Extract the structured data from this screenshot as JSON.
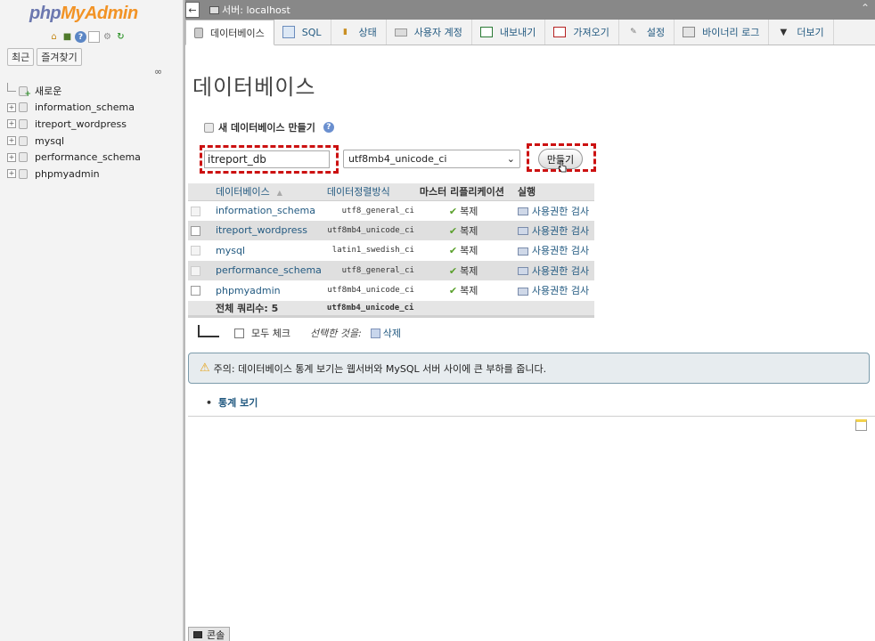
{
  "nav": {
    "logo_php": "php",
    "logo_myadmin": "MyAdmin",
    "tabs": [
      "최근",
      "즐겨찾기"
    ],
    "tree": [
      {
        "label": "새로운",
        "type": "new"
      },
      {
        "label": "information_schema",
        "type": "db"
      },
      {
        "label": "itreport_wordpress",
        "type": "db"
      },
      {
        "label": "mysql",
        "type": "db"
      },
      {
        "label": "performance_schema",
        "type": "db"
      },
      {
        "label": "phpmyadmin",
        "type": "db"
      }
    ]
  },
  "topbar": {
    "back": "←",
    "server": "서버: localhost",
    "collapse": "⌃"
  },
  "menu": [
    {
      "label": "데이터베이스",
      "icon": "database-icon",
      "active": true
    },
    {
      "label": "SQL",
      "icon": "sql-icon"
    },
    {
      "label": "상태",
      "icon": "status-icon"
    },
    {
      "label": "사용자 계정",
      "icon": "users-icon"
    },
    {
      "label": "내보내기",
      "icon": "export-icon"
    },
    {
      "label": "가져오기",
      "icon": "import-icon"
    },
    {
      "label": "설정",
      "icon": "settings-icon"
    },
    {
      "label": "바이너리 로그",
      "icon": "binary-log-icon"
    },
    {
      "label": "더보기",
      "icon": "more-icon"
    }
  ],
  "main": {
    "title": "데이터베이스",
    "create_heading": "새 데이터베이스 만들기",
    "db_name_value": "itreport_db",
    "collation_value": "utf8mb4_unicode_ci",
    "create_button": "만들기",
    "highlight_color": "#cc1111"
  },
  "table": {
    "headers": [
      "데이터베이스",
      "데이터정렬방식",
      "마스터 리플리케이션",
      "실행"
    ],
    "rows": [
      {
        "name": "information_schema",
        "collation": "utf8_general_ci",
        "replication": "복제",
        "action": "사용권한 검사",
        "system": true
      },
      {
        "name": "itreport_wordpress",
        "collation": "utf8mb4_unicode_ci",
        "replication": "복제",
        "action": "사용권한 검사",
        "system": false
      },
      {
        "name": "mysql",
        "collation": "latin1_swedish_ci",
        "replication": "복제",
        "action": "사용권한 검사",
        "system": true
      },
      {
        "name": "performance_schema",
        "collation": "utf8_general_ci",
        "replication": "복제",
        "action": "사용권한 검사",
        "system": true
      },
      {
        "name": "phpmyadmin",
        "collation": "utf8mb4_unicode_ci",
        "replication": "복제",
        "action": "사용권한 검사",
        "system": false
      }
    ],
    "footer_label": "전체 쿼리수: 5",
    "footer_collation": "utf8mb4_unicode_ci"
  },
  "bulk": {
    "check_all": "모두 체크",
    "with_selected": "선택한 것을:",
    "delete": "삭제"
  },
  "notice": "주의: 데이터베이스 통계 보기는 웹서버와 MySQL 서버 사이에 큰 부하를 줍니다.",
  "stats_link": "통계 보기",
  "console": "콘솔"
}
